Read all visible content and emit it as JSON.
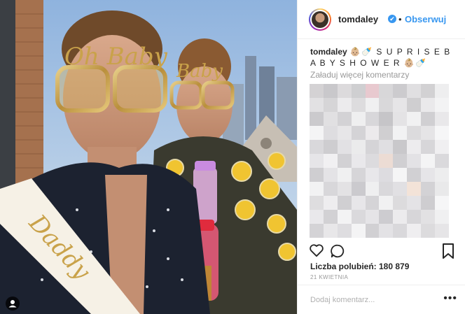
{
  "post": {
    "username": "tomdaley",
    "follow_label": "Obserwuj",
    "separator": "•",
    "verified_glyph": "✔",
    "caption_user": "tomdaley",
    "caption_text": "👶🏼🍼 S U P R I S E B A B Y S H O W E R 👶🏼🍼",
    "load_more": "Załaduj więcej komentarzy",
    "likes": "Liczba polubień: 180 879",
    "date": "21 kwietnia",
    "add_comment_placeholder": "Dodaj komentarz...",
    "more_options": "•••",
    "photo_text": {
      "glasses_left": "Oh Baby",
      "glasses_right": "Baby",
      "sash": "Daddy"
    }
  },
  "icons": [
    "heart-icon",
    "comment-icon",
    "bookmark-icon",
    "verified-badge-icon",
    "user-tag-icon",
    "more-options-icon"
  ],
  "colors": {
    "link": "#3897f0",
    "gold": "#c9a24a",
    "muted": "#999999"
  }
}
